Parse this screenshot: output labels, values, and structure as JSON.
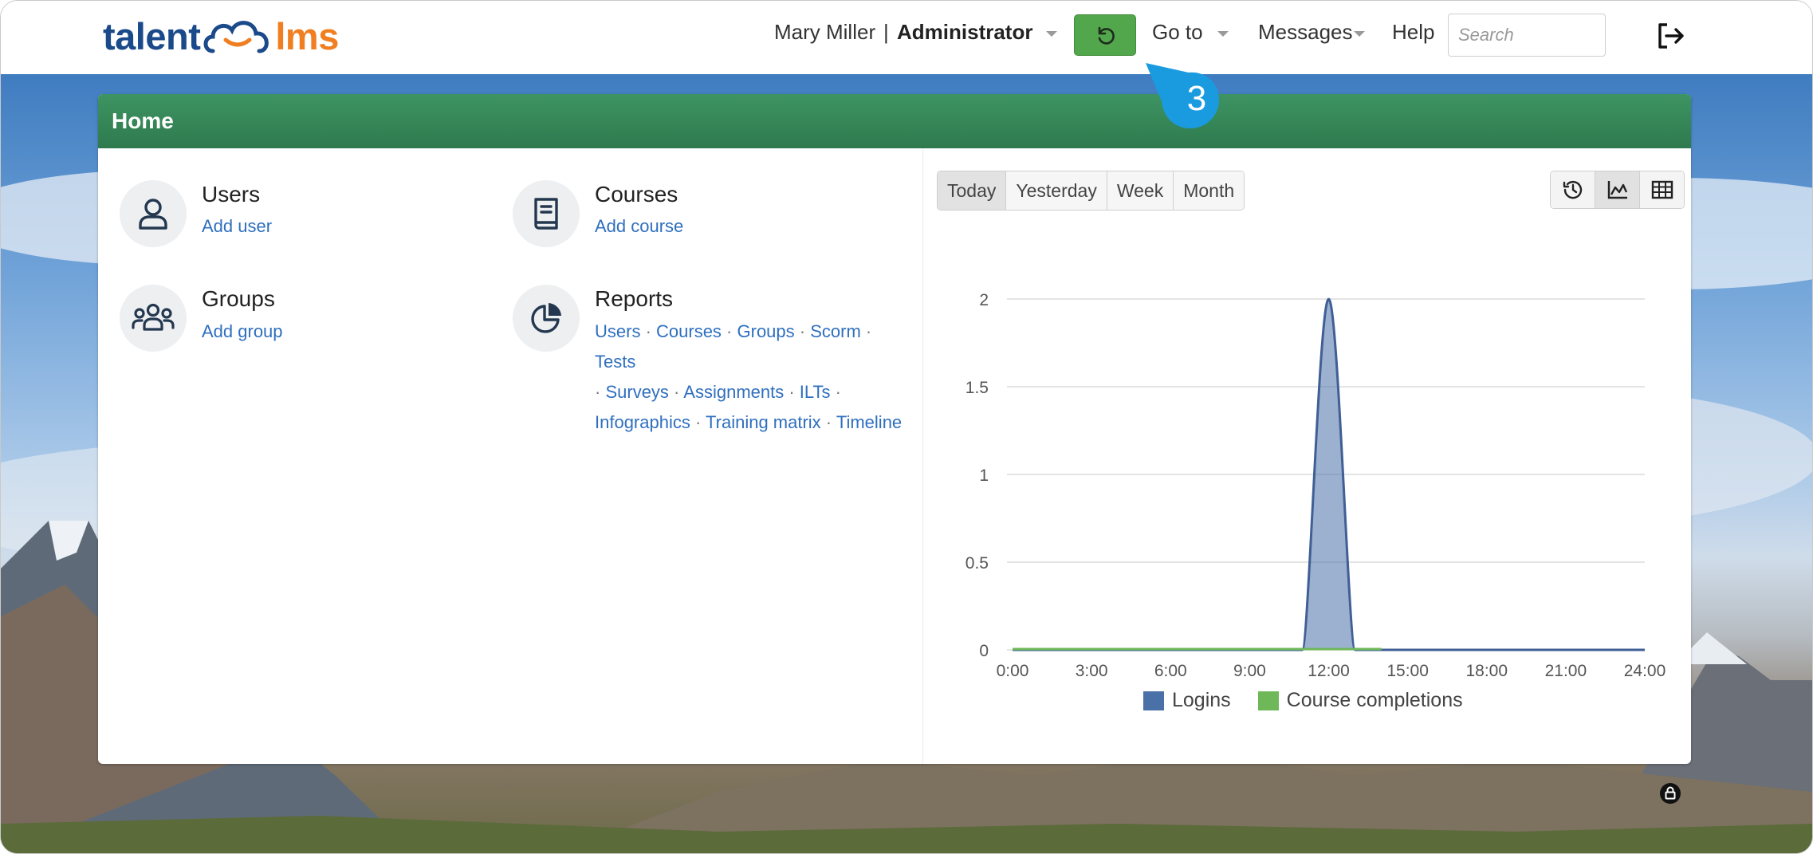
{
  "brand": {
    "part1": "talent",
    "part2": "lms"
  },
  "header": {
    "user_name": "Mary Miller",
    "separator": "|",
    "user_role": "Administrator",
    "goto_label": "Go to",
    "messages_label": "Messages",
    "help_label": "Help",
    "search_placeholder": "Search"
  },
  "tour": {
    "step": "3"
  },
  "home": {
    "title": "Home",
    "users": {
      "title": "Users",
      "link": "Add user"
    },
    "courses": {
      "title": "Courses",
      "link": "Add course"
    },
    "groups": {
      "title": "Groups",
      "link": "Add group"
    },
    "reports": {
      "title": "Reports",
      "links": [
        "Users",
        "Courses",
        "Groups",
        "Scorm",
        "Tests",
        "Surveys",
        "Assignments",
        "ILTs",
        "Infographics",
        "Training matrix",
        "Timeline"
      ]
    }
  },
  "chart_controls": {
    "ranges": [
      "Today",
      "Yesterday",
      "Week",
      "Month"
    ],
    "active_range": "Today",
    "views": [
      "history-icon",
      "area-chart-icon",
      "table-icon"
    ]
  },
  "chart_data": {
    "type": "area",
    "x": [
      "0:00",
      "3:00",
      "6:00",
      "9:00",
      "12:00",
      "15:00",
      "18:00",
      "21:00",
      "24:00"
    ],
    "ylim": [
      0,
      2
    ],
    "yticks": [
      "0",
      "0.5",
      "1",
      "1.5",
      "2"
    ],
    "grid": true,
    "legend_position": "bottom",
    "series": [
      {
        "name": "Logins",
        "color": "#4a70a8",
        "points": [
          [
            0,
            0
          ],
          [
            11,
            0
          ],
          [
            12,
            2
          ],
          [
            13,
            0
          ],
          [
            24,
            0
          ]
        ]
      },
      {
        "name": "Course completions",
        "color": "#6fb85a",
        "points": [
          [
            0,
            0
          ],
          [
            14,
            0
          ]
        ]
      }
    ]
  }
}
